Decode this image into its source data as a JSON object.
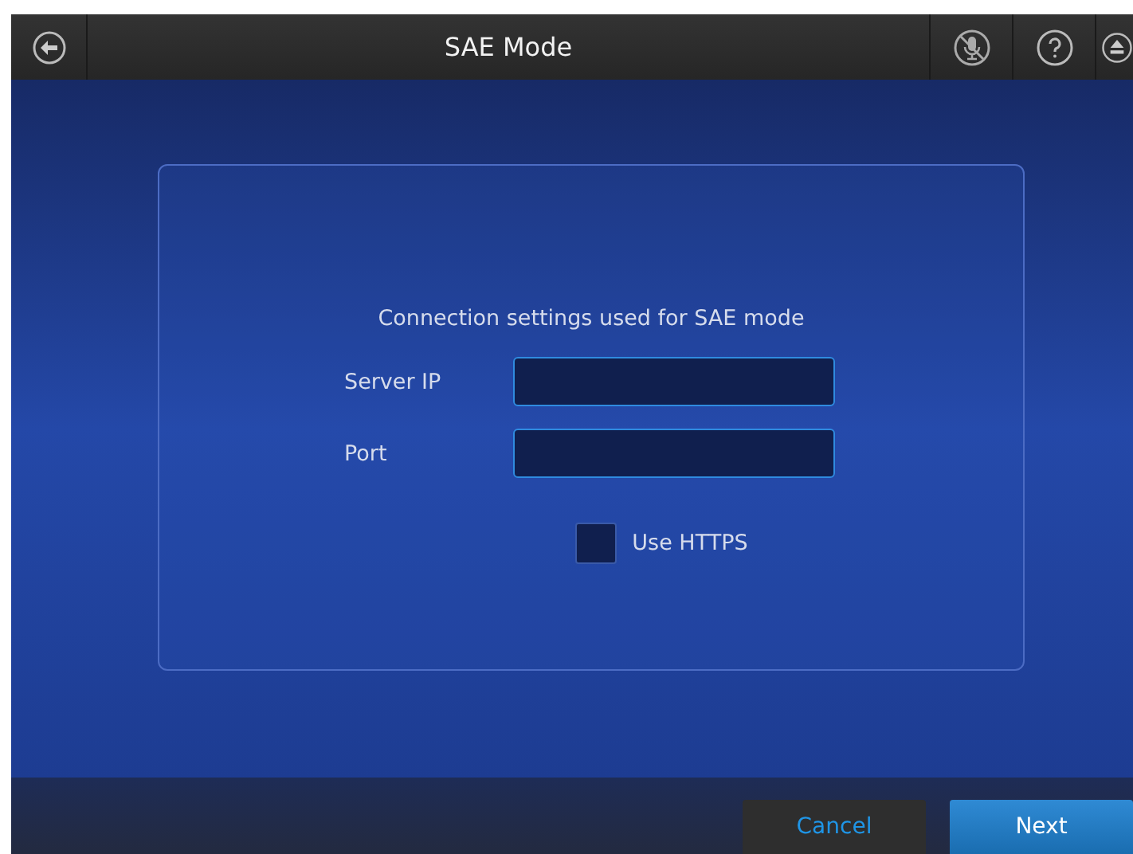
{
  "header": {
    "title": "SAE Mode"
  },
  "panel": {
    "heading": "Connection settings used for SAE mode",
    "fields": [
      {
        "label": "Server IP"
      },
      {
        "label": "Port"
      }
    ],
    "https": {
      "label": "Use HTTPS",
      "checked": false
    }
  },
  "footer": {
    "buttons": [
      {
        "label": "Cancel",
        "kind": "secondary"
      },
      {
        "label": "Next",
        "kind": "primary"
      }
    ]
  }
}
